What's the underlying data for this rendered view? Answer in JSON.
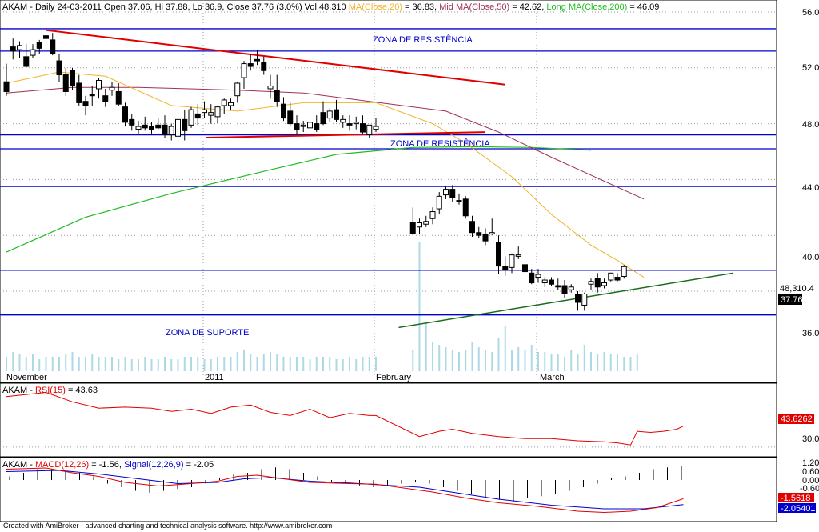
{
  "header": {
    "ticker": "AKAM",
    "title_prefix": "AKAM - Daily 24-03-2011 Open 37.06, Hi 37.88, Lo 36.9, Close 37.76 (3.0%) Vol 48,310",
    "ma20_label": "MA(Close,20)",
    "ma20_value": "= 36.83,",
    "ma50_label": "Mid MA(Close,50)",
    "ma50_value": "= 42.62,",
    "ma200_label": "Long MA(Close,200)",
    "ma200_value": "= 46.09"
  },
  "colors": {
    "candle_up": "#ffffff",
    "candle_down": "#000000",
    "volume": "#add8e6",
    "ma20": "#f0b429",
    "ma50": "#a0305a",
    "ma200": "#22bb22",
    "zone_lines": "#0000cc",
    "resistance_trend": "#e00000",
    "support_trend": "#1a6b1a",
    "rsi": "#e00000",
    "macd": "#e00000",
    "signal": "#0000cc"
  },
  "annotations": {
    "zone_res_1": "ZONA DE RESISTÊNCIA",
    "zone_res_2": "ZONA DE RESISTÊNCIA",
    "zone_sup": "ZONA DE SUPORTE"
  },
  "price_axis": {
    "ticks": [
      "56.0",
      "52.0",
      "48.0",
      "44.0",
      "40.0",
      "36.0"
    ],
    "vol_badge": "48,310.4",
    "price_badge": "37.76"
  },
  "x_axis": {
    "labels": [
      "November",
      "2011",
      "February",
      "March"
    ]
  },
  "rsi_panel": {
    "title_prefix": "AKAM -",
    "label": "RSI(15)",
    "value": "= 43.63",
    "ticks": [
      "30.0"
    ],
    "badge": "43.6262"
  },
  "macd_panel": {
    "title_prefix": "AKAM -",
    "macd_label": "MACD(12,26)",
    "macd_value": "= -1.56,",
    "signal_label": "Signal(12,26,9)",
    "signal_value": "= -2.05",
    "ticks": [
      "1.20",
      "0.60",
      "0.00",
      "-0.60"
    ],
    "badge_macd": "-1.5618",
    "badge_signal": "-2.05401"
  },
  "footer": "Created with AmiBroker - advanced charting and technical analysis software. http://www.amibroker.com",
  "chart_data": {
    "type": "candlestick",
    "ylim": [
      34,
      57
    ],
    "ohlc": [
      [
        51.0,
        52.3,
        50.0,
        50.3
      ],
      [
        53.5,
        54.1,
        52.6,
        53.2
      ],
      [
        53.3,
        53.9,
        52.7,
        53.6
      ],
      [
        52.8,
        53.7,
        52.0,
        52.1
      ],
      [
        52.9,
        53.7,
        52.7,
        53.3
      ],
      [
        53.8,
        54.0,
        53.0,
        53.4
      ],
      [
        54.3,
        54.7,
        53.6,
        54.1
      ],
      [
        54.0,
        54.5,
        52.9,
        53.0
      ],
      [
        52.5,
        53.0,
        51.0,
        51.5
      ],
      [
        51.5,
        52.0,
        50.0,
        50.3
      ],
      [
        51.8,
        52.0,
        50.4,
        50.7
      ],
      [
        50.9,
        51.5,
        49.3,
        49.5
      ],
      [
        49.6,
        50.0,
        48.6,
        49.3
      ],
      [
        50.1,
        50.7,
        49.3,
        50.0
      ],
      [
        50.5,
        51.3,
        49.8,
        51.1
      ],
      [
        50.0,
        50.5,
        49.2,
        49.6
      ],
      [
        50.4,
        51.0,
        50.0,
        50.6
      ],
      [
        50.3,
        50.9,
        49.3,
        49.4
      ],
      [
        49.2,
        49.5,
        47.8,
        48.1
      ],
      [
        48.3,
        48.7,
        47.5,
        47.9
      ],
      [
        47.6,
        48.2,
        47.3,
        47.8
      ],
      [
        47.9,
        48.5,
        47.5,
        47.7
      ],
      [
        47.8,
        48.1,
        47.3,
        47.6
      ],
      [
        47.9,
        48.4,
        47.6,
        47.7
      ],
      [
        47.9,
        48.6,
        47.0,
        47.2
      ],
      [
        47.2,
        48.0,
        46.8,
        47.8
      ],
      [
        47.1,
        48.4,
        46.8,
        48.3
      ],
      [
        48.3,
        49.0,
        46.8,
        47.5
      ],
      [
        47.9,
        49.2,
        47.7,
        49.0
      ],
      [
        48.7,
        49.4,
        47.9,
        48.4
      ],
      [
        48.8,
        49.6,
        48.4,
        49.0
      ],
      [
        48.6,
        49.4,
        48.0,
        48.8
      ],
      [
        48.5,
        49.3,
        48.0,
        49.2
      ],
      [
        49.3,
        49.8,
        48.7,
        49.7
      ],
      [
        49.3,
        49.8,
        49.0,
        49.5
      ],
      [
        50.0,
        51.0,
        49.5,
        50.9
      ],
      [
        51.3,
        52.5,
        50.5,
        52.3
      ],
      [
        52.3,
        53.0,
        51.8,
        52.1
      ],
      [
        52.6,
        53.3,
        52.2,
        52.5
      ],
      [
        52.4,
        52.8,
        51.5,
        51.8
      ],
      [
        50.5,
        51.5,
        49.8,
        50.7
      ],
      [
        50.4,
        51.5,
        49.2,
        49.6
      ],
      [
        49.4,
        49.9,
        48.2,
        48.4
      ],
      [
        48.9,
        49.5,
        47.8,
        48.0
      ],
      [
        48.0,
        48.6,
        47.2,
        47.6
      ],
      [
        47.8,
        48.2,
        47.4,
        47.9
      ],
      [
        47.7,
        48.3,
        47.3,
        48.1
      ],
      [
        48.0,
        48.6,
        47.4,
        47.6
      ],
      [
        48.8,
        49.6,
        47.9,
        48.0
      ],
      [
        48.4,
        49.1,
        48.1,
        48.9
      ],
      [
        49.0,
        49.7,
        48.1,
        48.3
      ],
      [
        48.1,
        48.6,
        47.7,
        48.3
      ],
      [
        48.0,
        48.6,
        47.5,
        47.9
      ],
      [
        48.0,
        48.5,
        47.6,
        48.1
      ],
      [
        48.0,
        48.6,
        47.3,
        47.4
      ],
      [
        47.2,
        47.9,
        47.0,
        47.9
      ],
      [
        47.6,
        48.4,
        47.4,
        47.8
      ],
      [
        40.9,
        42.0,
        40.0,
        40.1
      ],
      [
        40.6,
        41.2,
        40.1,
        40.9
      ],
      [
        40.8,
        41.4,
        40.6,
        41.0
      ],
      [
        41.2,
        42.0,
        40.8,
        41.7
      ],
      [
        41.9,
        43.1,
        41.5,
        42.8
      ],
      [
        42.9,
        43.5,
        42.6,
        43.3
      ],
      [
        43.3,
        43.6,
        42.4,
        42.7
      ],
      [
        42.5,
        43.0,
        42.2,
        42.4
      ],
      [
        42.6,
        42.8,
        41.2,
        41.4
      ],
      [
        41.0,
        41.4,
        39.9,
        40.2
      ],
      [
        40.2,
        40.6,
        39.8,
        40.0
      ],
      [
        40.1,
        40.5,
        39.3,
        39.6
      ],
      [
        40.1,
        41.2,
        40.0,
        40.2
      ],
      [
        39.5,
        40.0,
        37.2,
        37.8
      ],
      [
        37.8,
        38.5,
        37.1,
        37.5
      ],
      [
        37.7,
        38.7,
        37.3,
        38.6
      ],
      [
        38.5,
        39.2,
        38.3,
        38.6
      ],
      [
        37.9,
        38.3,
        37.1,
        37.4
      ],
      [
        37.3,
        37.6,
        36.5,
        36.6
      ],
      [
        37.0,
        37.6,
        36.6,
        37.2
      ],
      [
        36.6,
        37.0,
        36.3,
        36.8
      ],
      [
        36.8,
        37.0,
        36.4,
        36.5
      ],
      [
        36.4,
        36.9,
        36.1,
        36.3
      ],
      [
        36.4,
        36.8,
        35.5,
        35.8
      ],
      [
        36.1,
        36.5,
        35.9,
        36.3
      ],
      [
        35.8,
        36.0,
        34.6,
        35.2
      ],
      [
        35.0,
        35.9,
        34.6,
        35.8
      ],
      [
        36.5,
        36.9,
        36.1,
        36.7
      ],
      [
        36.9,
        37.3,
        35.9,
        36.3
      ],
      [
        36.4,
        36.9,
        36.2,
        36.6
      ],
      [
        36.8,
        37.3,
        36.7,
        37.3
      ],
      [
        37.0,
        37.3,
        36.7,
        36.8
      ],
      [
        37.06,
        37.88,
        36.9,
        37.76
      ]
    ],
    "gap_after_index": 56,
    "volume_relative": [
      0.3,
      0.4,
      0.35,
      0.3,
      0.35,
      0.25,
      0.3,
      0.3,
      0.3,
      0.35,
      0.4,
      0.3,
      0.3,
      0.35,
      0.3,
      0.3,
      0.3,
      0.25,
      0.3,
      0.25,
      0.25,
      0.3,
      0.25,
      0.25,
      0.3,
      0.25,
      0.25,
      0.3,
      0.3,
      0.3,
      0.25,
      0.25,
      0.3,
      0.3,
      0.3,
      0.4,
      0.45,
      0.35,
      0.3,
      0.35,
      0.4,
      0.35,
      0.3,
      0.3,
      0.3,
      0.3,
      0.25,
      0.3,
      0.3,
      0.3,
      0.25,
      0.25,
      0.3,
      0.25,
      0.3,
      0.3,
      0.3,
      0.45,
      2.7,
      1.0,
      0.6,
      0.55,
      0.5,
      0.45,
      0.4,
      0.45,
      0.6,
      0.5,
      0.45,
      0.4,
      0.7,
      0.95,
      0.45,
      0.5,
      0.45,
      0.55,
      0.4,
      0.4,
      0.35,
      0.35,
      0.3,
      0.45,
      0.35,
      0.55,
      0.4,
      0.35,
      0.4,
      0.35,
      0.35,
      0.3,
      0.3,
      0.35
    ],
    "ma20": [
      [
        0,
        50.9
      ],
      [
        8,
        51.7
      ],
      [
        15,
        51.4
      ],
      [
        25,
        49.3
      ],
      [
        35,
        48.9
      ],
      [
        45,
        49.5
      ],
      [
        56,
        49.5
      ],
      [
        60,
        48.0
      ],
      [
        65,
        46.6
      ],
      [
        72,
        44.2
      ],
      [
        78,
        41.5
      ],
      [
        84,
        39.3
      ],
      [
        88,
        38.2
      ],
      [
        92,
        37.0
      ]
    ],
    "ma50": [
      [
        0,
        50.2
      ],
      [
        10,
        50.6
      ],
      [
        20,
        50.6
      ],
      [
        35,
        50.4
      ],
      [
        45,
        50.2
      ],
      [
        55,
        49.6
      ],
      [
        62,
        48.9
      ],
      [
        70,
        47.4
      ],
      [
        78,
        45.6
      ],
      [
        85,
        44.1
      ],
      [
        92,
        42.6
      ]
    ],
    "ma200": [
      [
        0,
        38.8
      ],
      [
        12,
        41.3
      ],
      [
        25,
        43.0
      ],
      [
        40,
        44.7
      ],
      [
        50,
        45.8
      ],
      [
        57,
        46.3
      ],
      [
        66,
        46.35
      ],
      [
        75,
        46.3
      ],
      [
        84,
        46.1
      ]
    ],
    "zones": [
      54.8,
      53.2,
      47.2,
      46.2,
      43.5,
      37.5,
      34.3
    ],
    "resistance_line": [
      [
        6,
        54.7
      ],
      [
        71,
        50.8
      ]
    ],
    "lower_red_line": [
      [
        0,
        47.0
      ],
      [
        68,
        47.4
      ]
    ],
    "support_line": [
      [
        54,
        33.4
      ],
      [
        99,
        37.3
      ]
    ],
    "rsi": [
      [
        0,
        78
      ],
      [
        6,
        82
      ],
      [
        10,
        73
      ],
      [
        14,
        67
      ],
      [
        18,
        68
      ],
      [
        22,
        67
      ],
      [
        25,
        64
      ],
      [
        28,
        66
      ],
      [
        31,
        62
      ],
      [
        34,
        68
      ],
      [
        37,
        70
      ],
      [
        40,
        63
      ],
      [
        43,
        60
      ],
      [
        46,
        66
      ],
      [
        49,
        58
      ],
      [
        52,
        62
      ],
      [
        55,
        60
      ],
      [
        56,
        60
      ],
      [
        58,
        40
      ],
      [
        61,
        45
      ],
      [
        63,
        47
      ],
      [
        66,
        43
      ],
      [
        70,
        40
      ],
      [
        74,
        38
      ],
      [
        78,
        38
      ],
      [
        82,
        36
      ],
      [
        86,
        35
      ],
      [
        88,
        34
      ],
      [
        90,
        32
      ],
      [
        91,
        45
      ],
      [
        93,
        44
      ],
      [
        95,
        45
      ],
      [
        97,
        47
      ],
      [
        98,
        50
      ]
    ],
    "rsi_ylim": [
      20,
      90
    ],
    "macd": [
      [
        0,
        0.9
      ],
      [
        6,
        1.0
      ],
      [
        10,
        0.6
      ],
      [
        14,
        0.3
      ],
      [
        18,
        -0.2
      ],
      [
        23,
        -0.5
      ],
      [
        28,
        -0.3
      ],
      [
        32,
        -0.1
      ],
      [
        35,
        0.3
      ],
      [
        38,
        0.4
      ],
      [
        42,
        0.1
      ],
      [
        46,
        -0.2
      ],
      [
        52,
        -0.3
      ],
      [
        56,
        -0.35
      ],
      [
        60,
        -1.0
      ],
      [
        65,
        -1.5
      ],
      [
        70,
        -1.9
      ],
      [
        76,
        -2.2
      ],
      [
        82,
        -2.6
      ],
      [
        86,
        -2.7
      ],
      [
        90,
        -2.6
      ],
      [
        94,
        -2.3
      ],
      [
        98,
        -1.56
      ]
    ],
    "signal": [
      [
        0,
        0.7
      ],
      [
        8,
        0.8
      ],
      [
        14,
        0.5
      ],
      [
        20,
        0.1
      ],
      [
        26,
        -0.3
      ],
      [
        32,
        -0.2
      ],
      [
        36,
        0.1
      ],
      [
        40,
        0.2
      ],
      [
        46,
        -0.1
      ],
      [
        52,
        -0.25
      ],
      [
        58,
        -0.6
      ],
      [
        64,
        -1.1
      ],
      [
        70,
        -1.6
      ],
      [
        78,
        -2.1
      ],
      [
        86,
        -2.4
      ],
      [
        92,
        -2.4
      ],
      [
        98,
        -2.05
      ]
    ],
    "macd_ylim": [
      -3.0,
      1.6
    ],
    "histogram": [
      0.1,
      0.2,
      0.3,
      0.3,
      0.25,
      0.2,
      0.1,
      -0.1,
      -0.2,
      -0.3,
      -0.35,
      -0.3,
      -0.25,
      -0.2,
      -0.1,
      0.05,
      0.15,
      0.2,
      0.3,
      0.35,
      0.3,
      0.2,
      0.1,
      -0.05,
      -0.1,
      -0.15,
      -0.2,
      -0.15,
      -0.1,
      -0.05,
      -0.1,
      -0.2,
      -0.3,
      -0.4,
      -0.5,
      -0.55,
      -0.6,
      -0.5,
      -0.45,
      -0.4,
      -0.3,
      -0.2,
      -0.1,
      0.05,
      0.1,
      0.2,
      0.3,
      0.35,
      0.4
    ]
  }
}
